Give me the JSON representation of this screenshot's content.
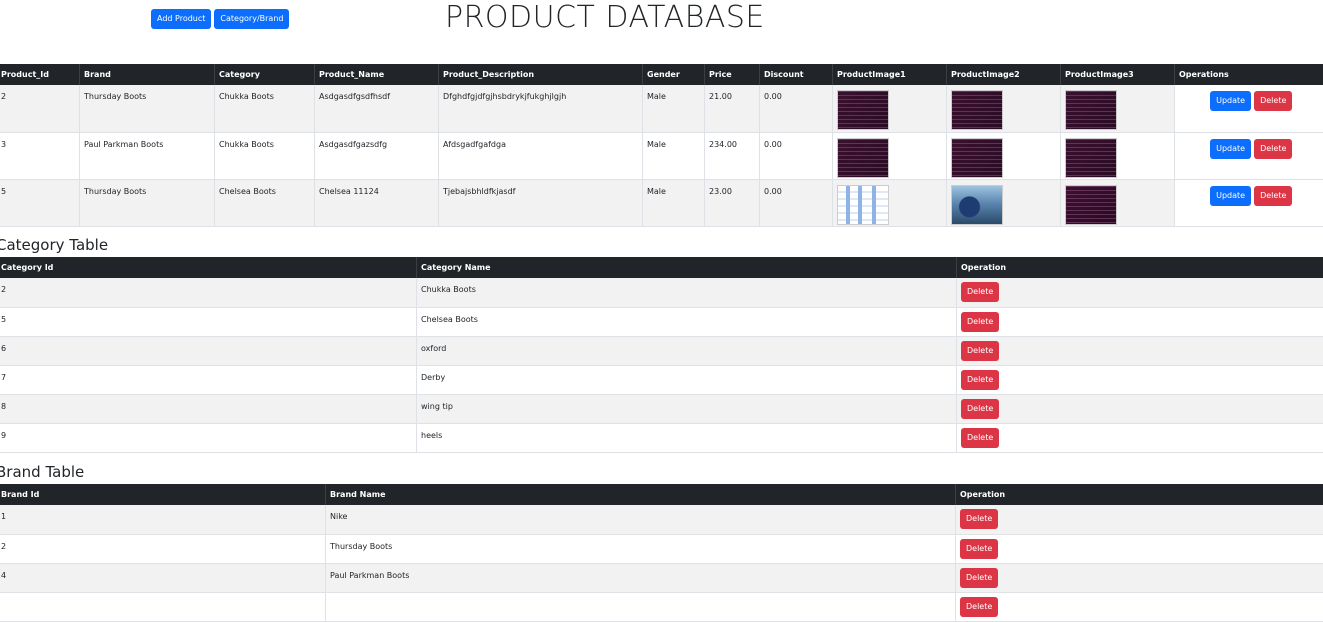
{
  "header": {
    "add_product_label": "Add Product",
    "category_brand_label": "Category/Brand",
    "title": "PRODUCT DATABASE"
  },
  "products": {
    "columns": [
      "Product_Id",
      "Brand",
      "Category",
      "Product_Name",
      "Product_Description",
      "Gender",
      "Price",
      "Discount",
      "ProductImage1",
      "ProductImage2",
      "ProductImage3",
      "Operations"
    ],
    "rows": [
      {
        "id": "2",
        "brand": "Thursday Boots",
        "category": "Chukka Boots",
        "name": "Asdgasdfgsdfhsdf",
        "description": "Dfghdfgjdfgjhsbdrykjfukghjlgjh",
        "gender": "Male",
        "price": "21.00",
        "discount": "0.00",
        "images": [
          "terminal",
          "terminal",
          "terminal"
        ]
      },
      {
        "id": "3",
        "brand": "Paul Parkman Boots",
        "category": "Chukka Boots",
        "name": "Asdgasdfgazsdfg",
        "description": "Afdsgadfgafdga",
        "gender": "Male",
        "price": "234.00",
        "discount": "0.00",
        "images": [
          "terminal",
          "terminal",
          "terminal"
        ]
      },
      {
        "id": "5",
        "brand": "Thursday Boots",
        "category": "Chelsea Boots",
        "name": "Chelsea 11124",
        "description": "Tjebajsbhldfkjasdf",
        "gender": "Male",
        "price": "23.00",
        "discount": "0.00",
        "images": [
          "diagram",
          "photo",
          "terminal"
        ]
      }
    ],
    "update_label": "Update",
    "delete_label": "Delete"
  },
  "categories": {
    "title": "Category Table",
    "columns": [
      "Category Id",
      "Category Name",
      "Operation"
    ],
    "rows": [
      {
        "id": "2",
        "name": "Chukka Boots"
      },
      {
        "id": "5",
        "name": "Chelsea Boots"
      },
      {
        "id": "6",
        "name": "oxford"
      },
      {
        "id": "7",
        "name": "Derby"
      },
      {
        "id": "8",
        "name": "wing tip"
      },
      {
        "id": "9",
        "name": "heels"
      }
    ],
    "delete_label": "Delete"
  },
  "brands": {
    "title": "Brand Table",
    "columns": [
      "Brand Id",
      "Brand Name",
      "Operation"
    ],
    "rows": [
      {
        "id": "1",
        "name": "Nike"
      },
      {
        "id": "2",
        "name": "Thursday Boots"
      },
      {
        "id": "4",
        "name": "Paul Parkman Boots"
      },
      {
        "id": "",
        "name": ""
      }
    ],
    "delete_label": "Delete"
  },
  "colors": {
    "primary": "#0d6efd",
    "danger": "#dc3545",
    "header_dark": "#212529",
    "stripe": "#f2f2f2"
  }
}
